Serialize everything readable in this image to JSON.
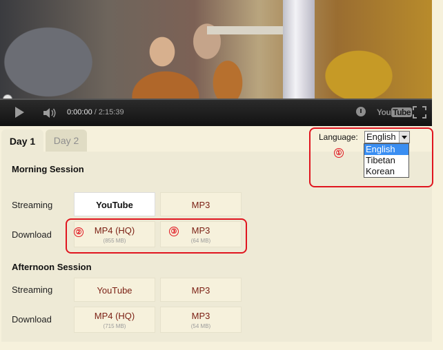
{
  "player": {
    "current_time": "0:00:00",
    "total_time": "2:15:39",
    "separator": " / ",
    "youtube_logo": "You",
    "youtube_logo_tube": "Tube"
  },
  "tabs": [
    {
      "label": "Day 1",
      "active": true
    },
    {
      "label": "Day 2",
      "active": false
    }
  ],
  "language": {
    "label": "Language:",
    "selected": "English",
    "options": [
      "English",
      "Tibetan",
      "Korean"
    ]
  },
  "morning": {
    "title": "Morning Session",
    "streaming_label": "Streaming",
    "download_label": "Download",
    "streaming": [
      {
        "label": "YouTube",
        "selected": true
      },
      {
        "label": "MP3"
      }
    ],
    "download": [
      {
        "label": "MP4 (HQ)",
        "size": "(855 MB)"
      },
      {
        "label": "MP3",
        "size": "(64 MB)"
      }
    ]
  },
  "afternoon": {
    "title": "Afternoon Session",
    "streaming_label": "Streaming",
    "download_label": "Download",
    "streaming": [
      {
        "label": "YouTube"
      },
      {
        "label": "MP3"
      }
    ],
    "download": [
      {
        "label": "MP4 (HQ)",
        "size": "(715 MB)"
      },
      {
        "label": "MP3",
        "size": "(54 MB)"
      }
    ]
  },
  "annotations": [
    "①",
    "②",
    "③"
  ],
  "colors": {
    "annotation": "#e0141e",
    "link": "#7a1e12",
    "highlight": "#3a8ef2"
  }
}
